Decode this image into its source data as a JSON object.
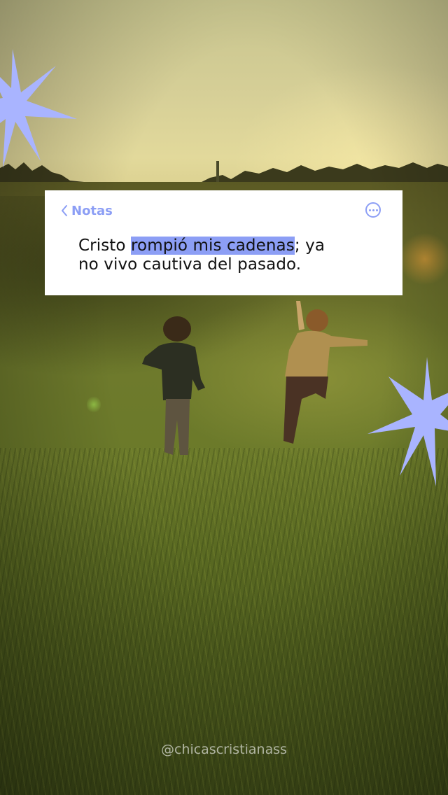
{
  "note": {
    "back_label": "Notas",
    "text_before": "Cristo ",
    "text_highlight": "rompió mis cadenas",
    "text_after_line1": "; ya",
    "text_line2": "no vivo cautiva del pasado."
  },
  "watermark": "@chicascristianass",
  "colors": {
    "accent": "#8c9ef5",
    "card_background": "#ffffff",
    "sparkle": "#a9b4ff"
  },
  "icons": {
    "back": "chevron-left-icon",
    "more": "more-options-icon",
    "decoration": "sparkle-star-icon"
  }
}
